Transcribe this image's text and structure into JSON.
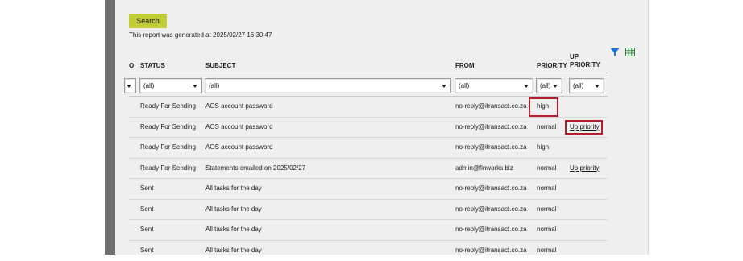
{
  "search": {
    "button_label": "Search"
  },
  "report_note": "This report was generated at 2025/02/27 16:30:47",
  "toolbar": {
    "filter_icon": "filter-icon",
    "export_icon": "spreadsheet-icon",
    "accent": "#1a73d9",
    "export_color": "#2e8b3a"
  },
  "columns": {
    "clipped": "O",
    "status": "STATUS",
    "subject": "SUBJECT",
    "from": "FROM",
    "priority": "PRIORITY",
    "up_priority_line1": "UP",
    "up_priority_line2": "PRIORITY"
  },
  "filters": {
    "clipped": "",
    "status": "(all)",
    "subject": "(all)",
    "from": "(all)",
    "priority": "(all)",
    "up_priority": "(all)"
  },
  "rows": [
    {
      "status": "Ready For Sending",
      "subject": "AOS account password",
      "from": "no-reply@itransact.co.za",
      "priority": "high",
      "up_priority": ""
    },
    {
      "status": "Ready For Sending",
      "subject": "AOS account password",
      "from": "no-reply@itransact.co.za",
      "priority": "normal",
      "up_priority": "Up priority"
    },
    {
      "status": "Ready For Sending",
      "subject": "AOS account password",
      "from": "no-reply@itransact.co.za",
      "priority": "high",
      "up_priority": ""
    },
    {
      "status": "Ready For Sending",
      "subject": "Statements emailed on 2025/02/27",
      "from": "admin@finworks.biz",
      "priority": "normal",
      "up_priority": "Up priority"
    },
    {
      "status": "Sent",
      "subject": "All tasks for the day",
      "from": "no-reply@itransact.co.za",
      "priority": "normal",
      "up_priority": ""
    },
    {
      "status": "Sent",
      "subject": "All tasks for the day",
      "from": "no-reply@itransact.co.za",
      "priority": "normal",
      "up_priority": ""
    },
    {
      "status": "Sent",
      "subject": "All tasks for the day",
      "from": "no-reply@itransact.co.za",
      "priority": "normal",
      "up_priority": ""
    },
    {
      "status": "Sent",
      "subject": "All tasks for the day",
      "from": "no-reply@itransact.co.za",
      "priority": "normal",
      "up_priority": ""
    }
  ],
  "annotation_color": "#b2202a"
}
